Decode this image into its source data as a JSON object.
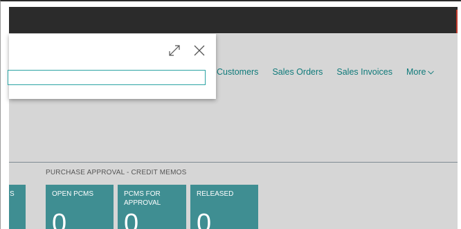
{
  "nav": {
    "items": [
      {
        "label": "Customers"
      },
      {
        "label": "Sales Orders"
      },
      {
        "label": "Sales Invoices"
      }
    ],
    "more_label": "More"
  },
  "section": {
    "title": "PURCHASE APPROVAL - CREDIT MEMOS"
  },
  "tiles": [
    {
      "label": "S",
      "count": ""
    },
    {
      "label": "OPEN PCMS",
      "count": "0"
    },
    {
      "label": "PCMS FOR\nAPPROVAL",
      "count": "0"
    },
    {
      "label": "RELEASED",
      "count": "0"
    }
  ],
  "dialog": {
    "search_value": "",
    "expand_icon": "expand-icon",
    "close_icon": "close-icon"
  },
  "colors": {
    "topbar": "#2b2b2b",
    "content_bg": "#d6d6d6",
    "accent": "#0f7a7a",
    "tile": "#3f8e92",
    "search_border": "#2aa3a3"
  }
}
